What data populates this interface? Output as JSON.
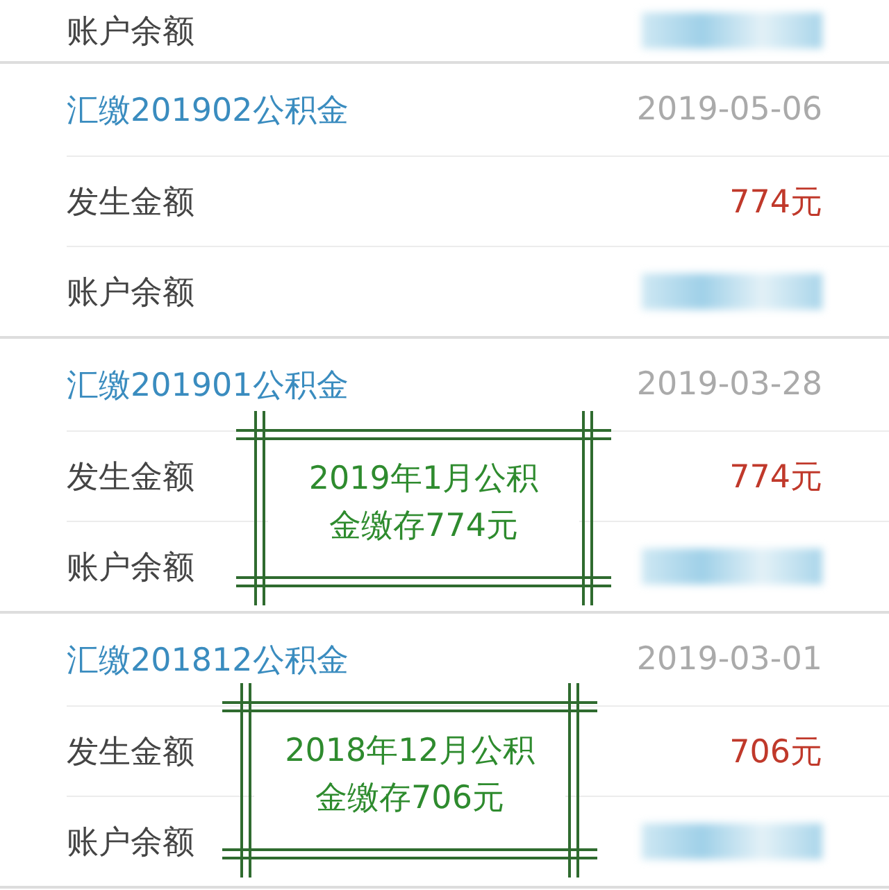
{
  "top_row": {
    "label": "账户余额"
  },
  "records": [
    {
      "title": "汇缴201902公积金",
      "date": "2019-05-06",
      "amount_label": "发生金额",
      "amount": "774元",
      "balance_label": "账户余额"
    },
    {
      "title": "汇缴201901公积金",
      "date": "2019-03-28",
      "amount_label": "发生金额",
      "amount": "774元",
      "balance_label": "账户余额",
      "note": {
        "lines": [
          "2019年1月公积",
          "金缴存774元"
        ]
      }
    },
    {
      "title": "汇缴201812公积金",
      "date": "2019-03-01",
      "amount_label": "发生金额",
      "amount": "706元",
      "balance_label": "账户余额",
      "note": {
        "lines": [
          "2018年12月公积",
          "金缴存706元"
        ]
      }
    }
  ]
}
